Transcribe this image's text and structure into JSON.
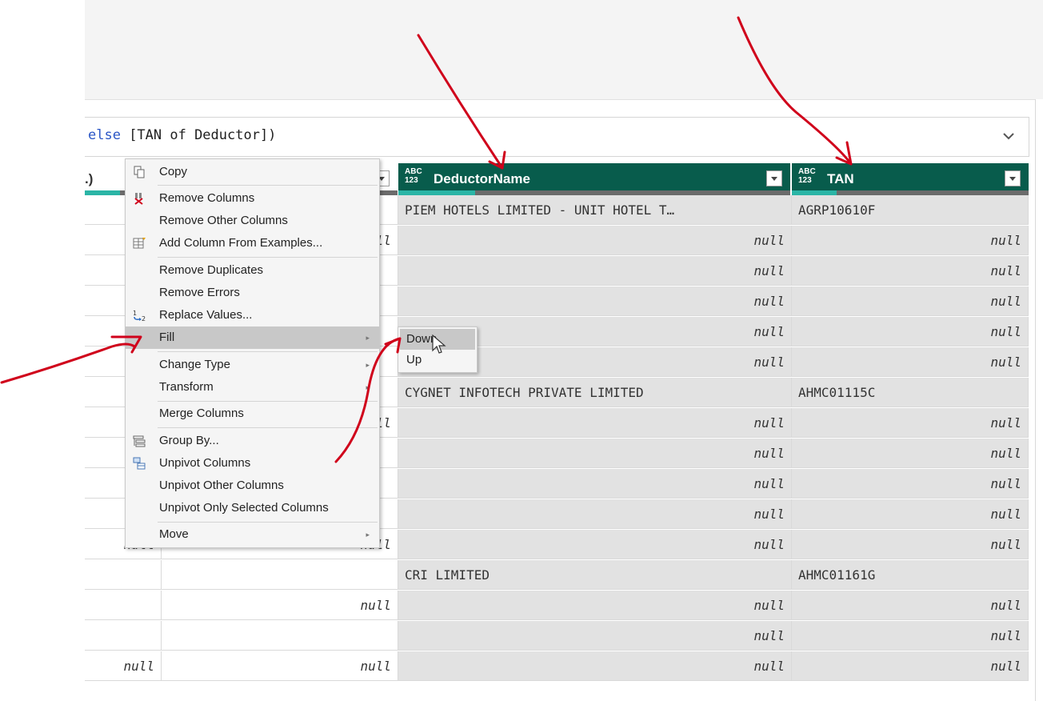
{
  "formula": {
    "text_keyword": "else",
    "text_rest": " [TAN of Deductor])"
  },
  "columns": {
    "partial_label": ".)",
    "deductor_name": {
      "type_icon_top": "ABC",
      "type_icon_bottom": "123",
      "label": "DeductorName"
    },
    "tan": {
      "type_icon_top": "ABC",
      "type_icon_bottom": "123",
      "label": "TAN"
    }
  },
  "rows": [
    {
      "a": "",
      "b": "",
      "name": "PIEM HOTELS LIMITED - UNIT HOTEL T…",
      "tan": "AGRP10610F"
    },
    {
      "a": "",
      "b": "null",
      "name": "null",
      "tan": "null"
    },
    {
      "a": "",
      "b": "",
      "name": "null",
      "tan": "null"
    },
    {
      "a": "",
      "b": "",
      "name": "null",
      "tan": "null"
    },
    {
      "a": "",
      "b": "",
      "name": "null",
      "tan": "null"
    },
    {
      "a": "n",
      "b": "",
      "name": "null",
      "tan": "null"
    },
    {
      "a": "",
      "b": "",
      "name": "CYGNET INFOTECH PRIVATE LIMITED",
      "tan": "AHMC01115C"
    },
    {
      "a": "",
      "b": "null",
      "name": "null",
      "tan": "null"
    },
    {
      "a": "",
      "b": "",
      "name": "null",
      "tan": "null"
    },
    {
      "a": "",
      "b": "",
      "name": "null",
      "tan": "null"
    },
    {
      "a": "",
      "b": "",
      "name": "null",
      "tan": "null"
    },
    {
      "a": "null",
      "b": "null",
      "name": "null",
      "tan": "null"
    },
    {
      "a": "",
      "b": "",
      "name": "CRI LIMITED",
      "tan": "AHMC01161G"
    },
    {
      "a": "",
      "b": "null",
      "name": "null",
      "tan": "null"
    },
    {
      "a": "",
      "b": "",
      "name": "null",
      "tan": "null"
    },
    {
      "a": "null",
      "b": "null",
      "name": "null",
      "tan": "null"
    }
  ],
  "context_menu": {
    "copy": "Copy",
    "remove_columns": "Remove Columns",
    "remove_other_columns": "Remove Other Columns",
    "add_column_from_examples": "Add Column From Examples...",
    "remove_duplicates": "Remove Duplicates",
    "remove_errors": "Remove Errors",
    "replace_values": "Replace Values...",
    "fill": "Fill",
    "change_type": "Change Type",
    "transform": "Transform",
    "merge_columns": "Merge Columns",
    "group_by": "Group By...",
    "unpivot_columns": "Unpivot Columns",
    "unpivot_other_columns": "Unpivot Other Columns",
    "unpivot_only_selected_columns": "Unpivot Only Selected Columns",
    "move": "Move"
  },
  "fill_submenu": {
    "down": "Down",
    "up": "Up"
  },
  "colors": {
    "header_bg": "#085c4c",
    "header_quality_fill": "#2bb5a6",
    "annotation": "#d0021b",
    "selected_cell": "#e2e2e2"
  }
}
